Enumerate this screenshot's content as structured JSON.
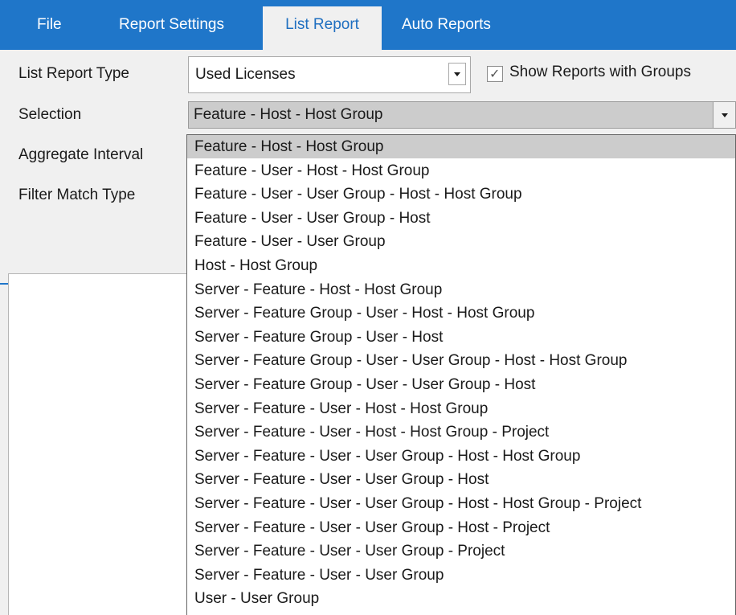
{
  "tabs": [
    {
      "label": "File",
      "active": false
    },
    {
      "label": "Report Settings",
      "active": false
    },
    {
      "label": "List Report",
      "active": true
    },
    {
      "label": "Auto Reports",
      "active": false
    }
  ],
  "form": {
    "list_report_type_label": "List Report Type",
    "list_report_type_value": "Used Licenses",
    "show_groups_checked": true,
    "show_groups_label": "Show Reports with  Groups",
    "selection_label": "Selection",
    "selection_value": "Feature - Host - Host Group",
    "aggregate_interval_label": "Aggregate Interval",
    "filter_match_type_label": "Filter Match Type"
  },
  "dropdown": {
    "selected_index": 0,
    "options": [
      "Feature - Host - Host Group",
      "Feature - User - Host - Host Group",
      "Feature - User - User Group - Host - Host Group",
      "Feature - User - User Group - Host",
      "Feature - User - User Group",
      "Host - Host Group",
      "Server - Feature - Host - Host Group",
      "Server - Feature Group - User - Host - Host Group",
      "Server - Feature Group - User - Host",
      "Server - Feature Group - User - User Group - Host - Host Group",
      "Server - Feature Group - User - User Group - Host",
      "Server - Feature - User - Host - Host Group",
      "Server - Feature - User - Host - Host Group - Project",
      "Server - Feature - User - User Group - Host - Host Group",
      "Server - Feature - User - User Group - Host",
      "Server - Feature - User - User Group - Host - Host Group - Project",
      "Server - Feature - User - User Group - Host - Project",
      "Server - Feature - User - User Group - Project",
      "Server - Feature - User - User Group",
      "User - User Group"
    ]
  },
  "colors": {
    "ribbon": "#1f76c9",
    "panel": "#f0f0f0",
    "active_tab_text": "#1f6fc0",
    "selected_option": "#cccccc"
  },
  "icons": {
    "combo_arrow": "chevron-down-icon",
    "checkbox_mark": "checkmark-icon"
  }
}
